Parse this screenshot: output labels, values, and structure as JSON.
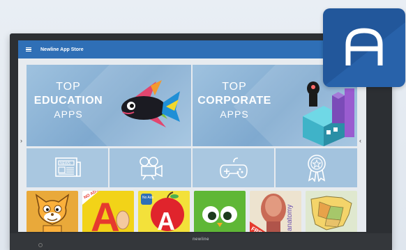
{
  "app": {
    "title": "Newline App Store",
    "brand": "newline"
  },
  "banners": [
    {
      "line1": "TOP",
      "line2": "EDUCATION",
      "line3": "APPS"
    },
    {
      "line1": "TOP",
      "line2": "CORPORATE",
      "line3": "APPS"
    }
  ],
  "categories": [
    {
      "icon": "newspaper-icon",
      "label": "NEWS"
    },
    {
      "icon": "movie-camera-icon"
    },
    {
      "icon": "gamepad-icon"
    },
    {
      "icon": "award-ribbon-icon"
    }
  ],
  "apps": [
    {
      "icon": "scratch-cat-icon"
    },
    {
      "icon": "letter-a-trace-icon",
      "badge": "NO ADS",
      "letter": "A"
    },
    {
      "icon": "apple-letter-a-icon",
      "badge": "No Ads",
      "letter": "A"
    },
    {
      "icon": "owl-icon"
    },
    {
      "icon": "anatomy-icon",
      "text1": "FREE",
      "text2": "anatomy"
    },
    {
      "icon": "spain-map-icon"
    }
  ],
  "nav": {
    "left": "›",
    "right": "‹"
  },
  "colors": {
    "appbar": "#2f6fb6",
    "banner": "#8fb5d8",
    "logo_bg": "#22579b"
  }
}
